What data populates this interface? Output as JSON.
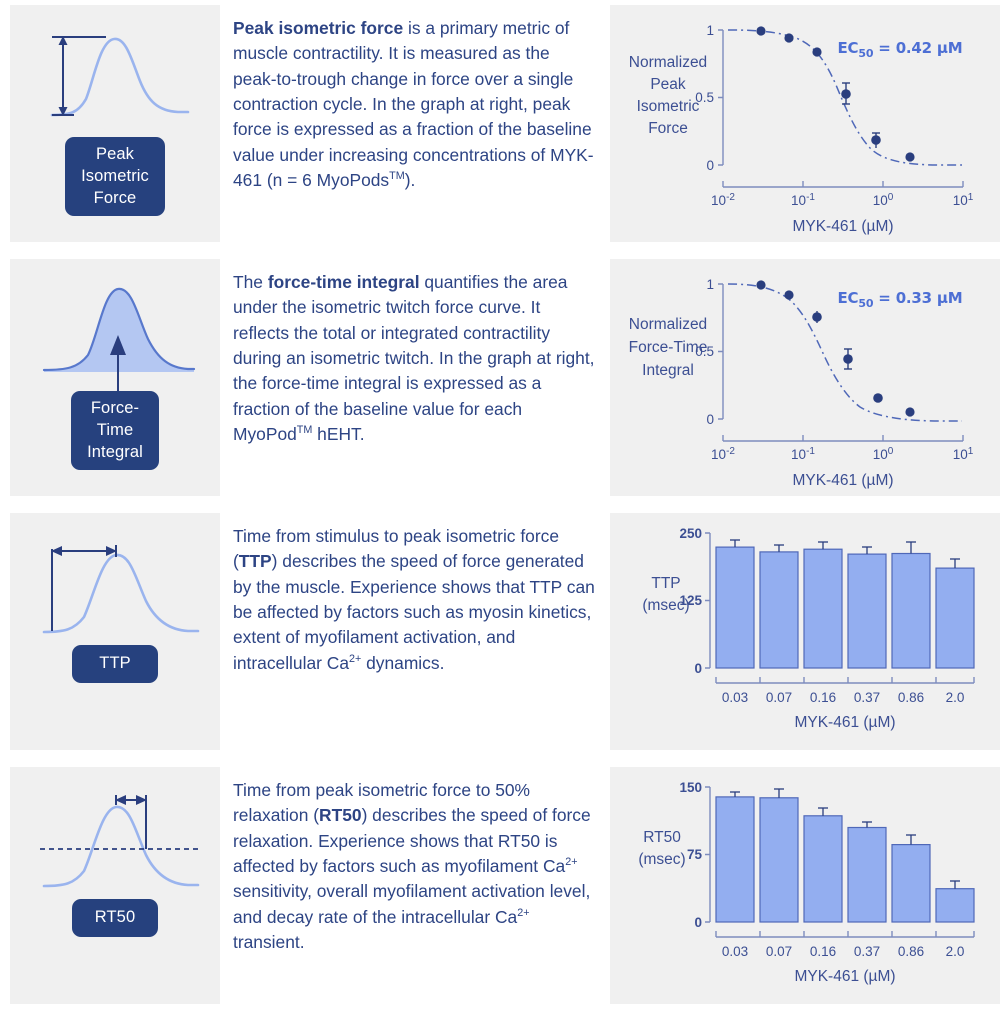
{
  "rows": [
    {
      "icon_name": "peak-isometric-force-icon",
      "badge_label_lines": [
        "Peak",
        "Isometric",
        "Force"
      ],
      "badge_label": "Peak Isometric Force",
      "paragraph": {
        "lead": "Peak isometric force",
        "rest_1": " is a primary metric of muscle contractility. It is measured as the peak-to-trough change in force over a single contraction cycle. In the graph at right, peak force is expressed as a fraction of the baseline value under increasing concentrations of MYK-461 (n = 6 MyoPods",
        "sup": "TM",
        "rest_2": ")."
      }
    },
    {
      "icon_name": "force-time-integral-icon",
      "badge_label_lines": [
        "Force-",
        "Time",
        "Integral"
      ],
      "badge_label": "Force-Time Integral",
      "paragraph": {
        "pre": "The ",
        "lead": "force-time integral",
        "rest_1": " quantifies the area under the isometric twitch force curve. It reflects the total or integrated contractility during an isometric twitch. In the graph at right, the force-time integral is expressed as a fraction of the baseline value for each MyoPod",
        "sup": "TM",
        "rest_2": " hEHT."
      }
    },
    {
      "icon_name": "ttp-icon",
      "badge_label_lines": [
        "TTP"
      ],
      "badge_label": "TTP",
      "paragraph": {
        "pre": "Time from stimulus to peak isometric force (",
        "lead": "TTP",
        "rest_1": ") describes the speed of force generated by the muscle. Experience shows that TTP can be affected by factors such as myosin kinetics, extent of myofilament activation, and intracellular Ca",
        "sup": "2+",
        "rest_2": " dynamics."
      }
    },
    {
      "icon_name": "rt50-icon",
      "badge_label_lines": [
        "RT50"
      ],
      "badge_label": "RT50",
      "paragraph": {
        "pre": "Time from peak isometric force to 50% relaxation (",
        "lead": "RT50",
        "rest_1": ") describes the speed of force relaxation. Experience shows that RT50 is affected by factors such as myofilament Ca",
        "sup": "2+",
        "rest_2": " sensitivity, overall myofilament activation level, and decay rate of the intracellular Ca",
        "sup2": "2+",
        "rest_3": " transient."
      }
    }
  ],
  "chart_data": [
    {
      "type": "line",
      "title": "",
      "ylabel": "Normalized Peak Isometric Force",
      "ylabel_lines": [
        "Normalized",
        "Peak",
        "Isometric",
        "Force"
      ],
      "xlabel": "MYK-461 (µM)",
      "annotation": "EC₅₀ = 0.42 µM",
      "annotation_prefix": "EC",
      "annotation_sub": "50",
      "annotation_rest": " = 0.42 µM",
      "xscale": "log",
      "xlim": [
        0.01,
        10
      ],
      "ylim": [
        0,
        1
      ],
      "yticks": [
        0,
        0.5,
        1
      ],
      "ytick_labels": [
        "0",
        "0.5",
        "1"
      ],
      "xticks": [
        0.01,
        0.1,
        1,
        10
      ],
      "xtick_labels": [
        "10-2",
        "10-1",
        "100",
        "101"
      ],
      "xtick_mantissa": "10",
      "xtick_exponents": [
        "-2",
        "-1",
        "0",
        "1"
      ],
      "grid": false,
      "legend": "none",
      "x": [
        0.03,
        0.07,
        0.16,
        0.37,
        0.86,
        2.0
      ],
      "values": [
        1.0,
        0.95,
        0.84,
        0.57,
        0.21,
        0.06
      ],
      "errors": [
        0.01,
        0.015,
        0.015,
        0.05,
        0.035,
        0.012
      ]
    },
    {
      "type": "line",
      "title": "",
      "ylabel": "Normalized Force-Time Integral",
      "ylabel_lines": [
        "Normalized",
        "Force-Time",
        "Integral"
      ],
      "xlabel": "MYK-461 (µM)",
      "annotation": "EC₅₀ = 0.33 µM",
      "annotation_prefix": "EC",
      "annotation_sub": "50",
      "annotation_rest": " = 0.33 µM",
      "xscale": "log",
      "xlim": [
        0.01,
        10
      ],
      "ylim": [
        0,
        1
      ],
      "yticks": [
        0,
        0.5,
        1
      ],
      "ytick_labels": [
        "0",
        "0.5",
        "1"
      ],
      "xticks": [
        0.01,
        0.1,
        1,
        10
      ],
      "xtick_labels": [
        "10-2",
        "10-1",
        "100",
        "101"
      ],
      "xtick_mantissa": "10",
      "xtick_exponents": [
        "-2",
        "-1",
        "0",
        "1"
      ],
      "grid": false,
      "legend": "none",
      "x": [
        0.03,
        0.07,
        0.16,
        0.37,
        0.86,
        2.0
      ],
      "values": [
        1.0,
        0.93,
        0.76,
        0.47,
        0.16,
        0.05
      ],
      "errors": [
        0.012,
        0.015,
        0.02,
        0.04,
        0.018,
        0.012
      ]
    },
    {
      "type": "bar",
      "title": "",
      "ylabel": "TTP (msec)",
      "ylabel_lines": [
        "TTP",
        "(msec)"
      ],
      "xlabel": "MYK-461 (µM)",
      "categories": [
        "0.03",
        "0.07",
        "0.16",
        "0.37",
        "0.86",
        "2.0"
      ],
      "values": [
        224,
        215,
        220,
        211,
        212,
        185
      ],
      "errors": [
        6,
        5,
        5,
        5,
        9,
        7
      ],
      "ylim": [
        0,
        250
      ],
      "yticks": [
        0,
        125,
        250
      ],
      "ytick_labels": [
        "0",
        "125",
        "250"
      ],
      "grid": false,
      "legend": "none"
    },
    {
      "type": "bar",
      "title": "",
      "ylabel": "RT50 (msec)",
      "ylabel_lines": [
        "RT50",
        "(msec)"
      ],
      "xlabel": "MYK-461 (µM)",
      "categories": [
        "0.03",
        "0.07",
        "0.16",
        "0.37",
        "0.86",
        "2.0"
      ],
      "values": [
        139,
        138,
        118,
        105,
        86,
        37
      ],
      "errors": [
        4,
        7,
        6,
        4,
        8,
        5
      ],
      "ylim": [
        0,
        150
      ],
      "yticks": [
        0,
        75,
        150
      ],
      "ytick_labels": [
        "0",
        "75",
        "150"
      ],
      "grid": false,
      "legend": "none"
    }
  ],
  "colors": {
    "navy": "#2a3e7e",
    "badge": "#26417e",
    "accent": "#4d6fd4",
    "curve": "#9ab4ee",
    "bar_fill": "#93aef0",
    "bar_edge": "#4f68b8",
    "panel_bg": "#f0f0f0"
  }
}
